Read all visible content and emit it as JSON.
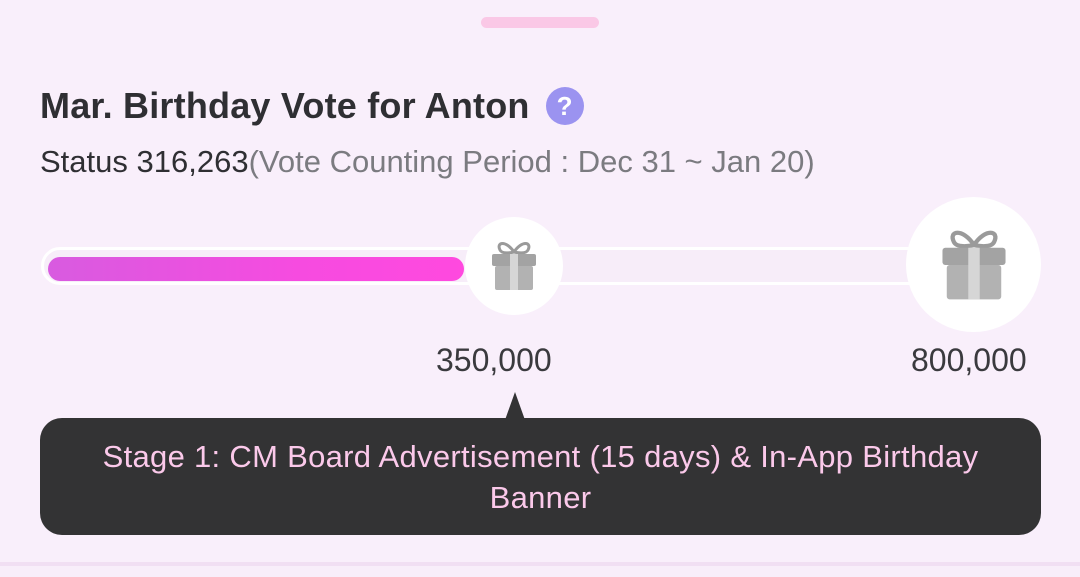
{
  "header": {
    "title": "Mar. Birthday Vote for Anton",
    "help_icon": "question-mark-icon"
  },
  "status": {
    "label": "Status",
    "value": "316,263",
    "period": "(Vote Counting Period : Dec 31 ~ Jan 20)"
  },
  "progress": {
    "current": 316263,
    "max": 800000,
    "fill_fraction": 0.4,
    "fill_color": "#f64be0",
    "milestones": [
      {
        "label": "350,000",
        "icon": "gift-box-icon"
      },
      {
        "label": "800,000",
        "icon": "gift-box-icon"
      }
    ]
  },
  "tooltip": {
    "text": "Stage 1: CM Board Advertisement (15 days) & In-App Birthday Banner"
  },
  "colors": {
    "background": "#f9effb",
    "help_icon": "#9b93f0",
    "tooltip_bg": "#333334",
    "tooltip_text": "#fbc9ea",
    "handle": "#fac8e6"
  }
}
